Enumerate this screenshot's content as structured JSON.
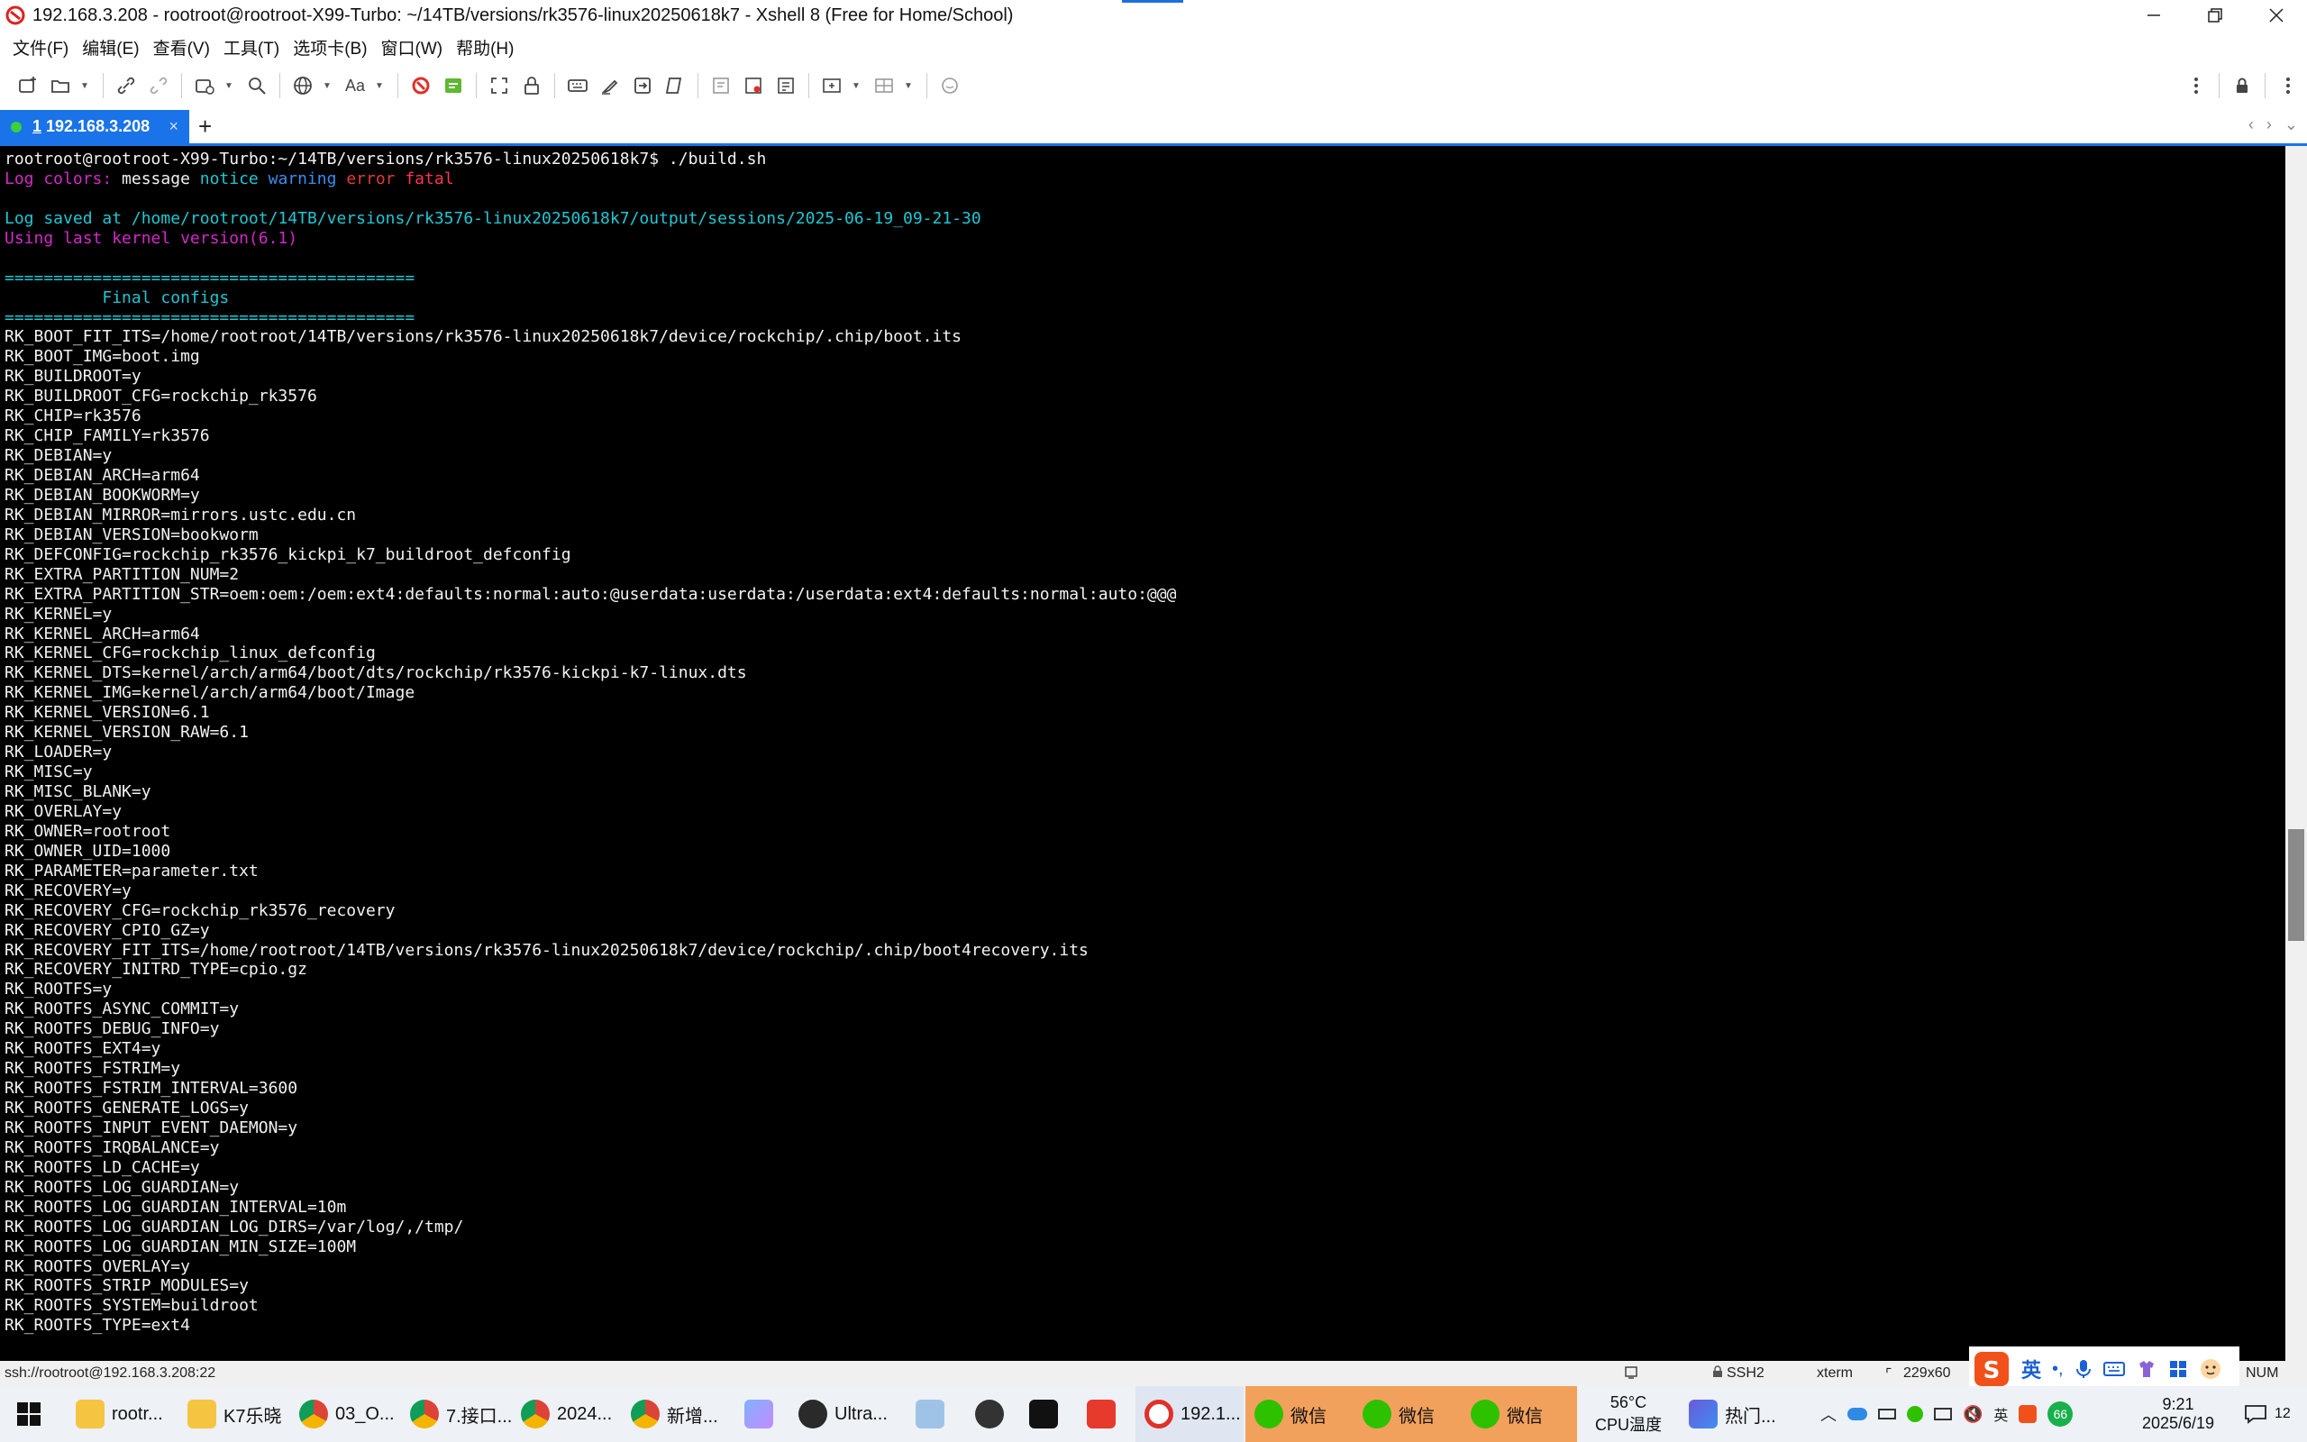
{
  "window": {
    "title": "192.168.3.208 - rootroot@rootroot-X99-Turbo: ~/14TB/versions/rk3576-linux20250618k7 - Xshell 8 (Free for Home/School)"
  },
  "menu": {
    "items": [
      "文件(F)",
      "编辑(E)",
      "查看(V)",
      "工具(T)",
      "选项卡(B)",
      "窗口(W)",
      "帮助(H)"
    ]
  },
  "toolbar": {
    "icons": [
      "new-session-icon",
      "open-icon",
      "link-icon",
      "unlink-icon",
      "reconnect-icon",
      "search-icon",
      "globe-icon",
      "font-icon",
      "xftp-icon",
      "xftp-green-icon",
      "fullscreen-icon",
      "lock-icon",
      "keyboard-icon",
      "highlight-icon",
      "transfer-icon",
      "script-icon",
      "compose-icon",
      "paste-icon",
      "log-icon",
      "add-frame-icon",
      "layout-icon",
      "chat-icon",
      "more-icon",
      "padlock-icon"
    ]
  },
  "tab": {
    "number": "1",
    "label": " 192.168.3.208",
    "close": "×",
    "add": "+"
  },
  "terminal": {
    "lines": [
      {
        "segments": [
          {
            "text": "rootroot@rootroot-X99-Turbo:~/14TB/versions/rk3576-linux20250618k7$ ./build.sh",
            "color": "white"
          }
        ]
      },
      {
        "segments": [
          {
            "text": "Log colors: ",
            "color": "magenta"
          },
          {
            "text": "message ",
            "color": "white"
          },
          {
            "text": "notice ",
            "color": "cyan"
          },
          {
            "text": "warning ",
            "color": "blue"
          },
          {
            "text": "error ",
            "color": "red"
          },
          {
            "text": "fatal",
            "color": "lightred"
          }
        ]
      },
      {
        "segments": [
          {
            "text": "",
            "color": "white"
          }
        ]
      },
      {
        "segments": [
          {
            "text": "Log saved at /home/rootroot/14TB/versions/rk3576-linux20250618k7/output/sessions/2025-06-19_09-21-30",
            "color": "cyan"
          }
        ]
      },
      {
        "segments": [
          {
            "text": "Using last kernel version(6.1)",
            "color": "magenta"
          }
        ]
      },
      {
        "segments": [
          {
            "text": "",
            "color": "white"
          }
        ]
      },
      {
        "segments": [
          {
            "text": "==========================================",
            "color": "cyan"
          }
        ]
      },
      {
        "segments": [
          {
            "text": "          Final configs",
            "color": "cyan"
          }
        ]
      },
      {
        "segments": [
          {
            "text": "==========================================",
            "color": "cyan"
          }
        ]
      },
      {
        "segments": [
          {
            "text": "RK_BOOT_FIT_ITS=/home/rootroot/14TB/versions/rk3576-linux20250618k7/device/rockchip/.chip/boot.its",
            "color": "white"
          }
        ]
      },
      {
        "segments": [
          {
            "text": "RK_BOOT_IMG=boot.img",
            "color": "white"
          }
        ]
      },
      {
        "segments": [
          {
            "text": "RK_BUILDROOT=y",
            "color": "white"
          }
        ]
      },
      {
        "segments": [
          {
            "text": "RK_BUILDROOT_CFG=rockchip_rk3576",
            "color": "white"
          }
        ]
      },
      {
        "segments": [
          {
            "text": "RK_CHIP=rk3576",
            "color": "white"
          }
        ]
      },
      {
        "segments": [
          {
            "text": "RK_CHIP_FAMILY=rk3576",
            "color": "white"
          }
        ]
      },
      {
        "segments": [
          {
            "text": "RK_DEBIAN=y",
            "color": "white"
          }
        ]
      },
      {
        "segments": [
          {
            "text": "RK_DEBIAN_ARCH=arm64",
            "color": "white"
          }
        ]
      },
      {
        "segments": [
          {
            "text": "RK_DEBIAN_BOOKWORM=y",
            "color": "white"
          }
        ]
      },
      {
        "segments": [
          {
            "text": "RK_DEBIAN_MIRROR=mirrors.ustc.edu.cn",
            "color": "white"
          }
        ]
      },
      {
        "segments": [
          {
            "text": "RK_DEBIAN_VERSION=bookworm",
            "color": "white"
          }
        ]
      },
      {
        "segments": [
          {
            "text": "RK_DEFCONFIG=rockchip_rk3576_kickpi_k7_buildroot_defconfig",
            "color": "white"
          }
        ]
      },
      {
        "segments": [
          {
            "text": "RK_EXTRA_PARTITION_NUM=2",
            "color": "white"
          }
        ]
      },
      {
        "segments": [
          {
            "text": "RK_EXTRA_PARTITION_STR=oem:oem:/oem:ext4:defaults:normal:auto:@userdata:userdata:/userdata:ext4:defaults:normal:auto:@@@",
            "color": "white"
          }
        ]
      },
      {
        "segments": [
          {
            "text": "RK_KERNEL=y",
            "color": "white"
          }
        ]
      },
      {
        "segments": [
          {
            "text": "RK_KERNEL_ARCH=arm64",
            "color": "white"
          }
        ]
      },
      {
        "segments": [
          {
            "text": "RK_KERNEL_CFG=rockchip_linux_defconfig",
            "color": "white"
          }
        ]
      },
      {
        "segments": [
          {
            "text": "RK_KERNEL_DTS=kernel/arch/arm64/boot/dts/rockchip/rk3576-kickpi-k7-linux.dts",
            "color": "white"
          }
        ]
      },
      {
        "segments": [
          {
            "text": "RK_KERNEL_IMG=kernel/arch/arm64/boot/Image",
            "color": "white"
          }
        ]
      },
      {
        "segments": [
          {
            "text": "RK_KERNEL_VERSION=6.1",
            "color": "white"
          }
        ]
      },
      {
        "segments": [
          {
            "text": "RK_KERNEL_VERSION_RAW=6.1",
            "color": "white"
          }
        ]
      },
      {
        "segments": [
          {
            "text": "RK_LOADER=y",
            "color": "white"
          }
        ]
      },
      {
        "segments": [
          {
            "text": "RK_MISC=y",
            "color": "white"
          }
        ]
      },
      {
        "segments": [
          {
            "text": "RK_MISC_BLANK=y",
            "color": "white"
          }
        ]
      },
      {
        "segments": [
          {
            "text": "RK_OVERLAY=y",
            "color": "white"
          }
        ]
      },
      {
        "segments": [
          {
            "text": "RK_OWNER=rootroot",
            "color": "white"
          }
        ]
      },
      {
        "segments": [
          {
            "text": "RK_OWNER_UID=1000",
            "color": "white"
          }
        ]
      },
      {
        "segments": [
          {
            "text": "RK_PARAMETER=parameter.txt",
            "color": "white"
          }
        ]
      },
      {
        "segments": [
          {
            "text": "RK_RECOVERY=y",
            "color": "white"
          }
        ]
      },
      {
        "segments": [
          {
            "text": "RK_RECOVERY_CFG=rockchip_rk3576_recovery",
            "color": "white"
          }
        ]
      },
      {
        "segments": [
          {
            "text": "RK_RECOVERY_CPIO_GZ=y",
            "color": "white"
          }
        ]
      },
      {
        "segments": [
          {
            "text": "RK_RECOVERY_FIT_ITS=/home/rootroot/14TB/versions/rk3576-linux20250618k7/device/rockchip/.chip/boot4recovery.its",
            "color": "white"
          }
        ]
      },
      {
        "segments": [
          {
            "text": "RK_RECOVERY_INITRD_TYPE=cpio.gz",
            "color": "white"
          }
        ]
      },
      {
        "segments": [
          {
            "text": "RK_ROOTFS=y",
            "color": "white"
          }
        ]
      },
      {
        "segments": [
          {
            "text": "RK_ROOTFS_ASYNC_COMMIT=y",
            "color": "white"
          }
        ]
      },
      {
        "segments": [
          {
            "text": "RK_ROOTFS_DEBUG_INFO=y",
            "color": "white"
          }
        ]
      },
      {
        "segments": [
          {
            "text": "RK_ROOTFS_EXT4=y",
            "color": "white"
          }
        ]
      },
      {
        "segments": [
          {
            "text": "RK_ROOTFS_FSTRIM=y",
            "color": "white"
          }
        ]
      },
      {
        "segments": [
          {
            "text": "RK_ROOTFS_FSTRIM_INTERVAL=3600",
            "color": "white"
          }
        ]
      },
      {
        "segments": [
          {
            "text": "RK_ROOTFS_GENERATE_LOGS=y",
            "color": "white"
          }
        ]
      },
      {
        "segments": [
          {
            "text": "RK_ROOTFS_INPUT_EVENT_DAEMON=y",
            "color": "white"
          }
        ]
      },
      {
        "segments": [
          {
            "text": "RK_ROOTFS_IRQBALANCE=y",
            "color": "white"
          }
        ]
      },
      {
        "segments": [
          {
            "text": "RK_ROOTFS_LD_CACHE=y",
            "color": "white"
          }
        ]
      },
      {
        "segments": [
          {
            "text": "RK_ROOTFS_LOG_GUARDIAN=y",
            "color": "white"
          }
        ]
      },
      {
        "segments": [
          {
            "text": "RK_ROOTFS_LOG_GUARDIAN_INTERVAL=10m",
            "color": "white"
          }
        ]
      },
      {
        "segments": [
          {
            "text": "RK_ROOTFS_LOG_GUARDIAN_LOG_DIRS=/var/log/,/tmp/",
            "color": "white"
          }
        ]
      },
      {
        "segments": [
          {
            "text": "RK_ROOTFS_LOG_GUARDIAN_MIN_SIZE=100M",
            "color": "white"
          }
        ]
      },
      {
        "segments": [
          {
            "text": "RK_ROOTFS_OVERLAY=y",
            "color": "white"
          }
        ]
      },
      {
        "segments": [
          {
            "text": "RK_ROOTFS_STRIP_MODULES=y",
            "color": "white"
          }
        ]
      },
      {
        "segments": [
          {
            "text": "RK_ROOTFS_SYSTEM=buildroot",
            "color": "white"
          }
        ]
      },
      {
        "segments": [
          {
            "text": "RK_ROOTFS_TYPE=ext4",
            "color": "white"
          }
        ]
      }
    ]
  },
  "statusbar": {
    "connection": "ssh://rootroot@192.168.3.208:22",
    "protocol": "SSH2",
    "terminal_type": "xterm",
    "size": "229x60",
    "num": "NUM"
  },
  "ime": {
    "lang": "英"
  },
  "taskbar": {
    "apps": [
      {
        "label": "rootr...",
        "icon": "folder-icon"
      },
      {
        "label": "K7乐晓",
        "icon": "folder-icon"
      },
      {
        "label": "03_O...",
        "icon": "chrome-icon"
      },
      {
        "label": "7.接口...",
        "icon": "chrome-icon"
      },
      {
        "label": "2024...",
        "icon": "chrome-icon"
      },
      {
        "label": "新增...",
        "icon": "chrome-icon"
      },
      {
        "label": "",
        "icon": "paint-icon"
      },
      {
        "label": "Ultra...",
        "icon": "ultraedit-icon"
      },
      {
        "label": "",
        "icon": "notepad-icon"
      },
      {
        "label": "",
        "icon": "app-icon"
      },
      {
        "label": "",
        "icon": "terminal-icon"
      },
      {
        "label": "",
        "icon": "wps-icon"
      },
      {
        "label": "192.1...",
        "icon": "xshell-icon"
      },
      {
        "label": "微信",
        "icon": "wechat-icon"
      },
      {
        "label": "微信",
        "icon": "wechat-icon"
      },
      {
        "label": "微信",
        "icon": "wechat-icon"
      }
    ],
    "weather_temp": "56°C",
    "weather_label": "CPU温度",
    "news_label": "热门...",
    "tray_badge": "66",
    "time": "9:21",
    "date": "2025/6/19",
    "notifications": "12"
  },
  "colors": {
    "white": "#f2f2f2",
    "cyan": "#1ec8d4",
    "magenta": "#d428c8",
    "blue": "#3b8ef0",
    "red": "#e23b3b",
    "lightred": "#ff3355",
    "tab_accent": "#1a73e8",
    "terminal_bg": "#000000"
  }
}
